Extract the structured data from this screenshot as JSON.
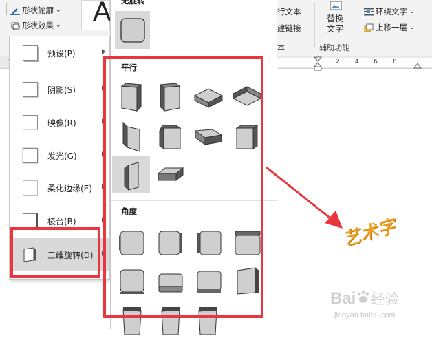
{
  "ribbon": {
    "shape_outline": "形状轮廓",
    "shape_effects": "形状效果",
    "big_letter": "A",
    "wrap_text_partial": "行文本",
    "link_partial": "建链接",
    "group_partial": "本",
    "alt_text_line1": "替换",
    "alt_text_line2": "文字",
    "accessibility_group": "辅助功能",
    "wrap_text": "环绕文字",
    "bring_forward": "上移一层"
  },
  "ruler": {
    "numbers": [
      "3",
      "2",
      "4",
      "6",
      "8"
    ]
  },
  "menu": {
    "items": [
      {
        "label": "预设(P)"
      },
      {
        "label": "阴影(S)"
      },
      {
        "label": "映像(R)"
      },
      {
        "label": "发光(G)"
      },
      {
        "label": "柔化边缘(E)"
      },
      {
        "label": "棱台(B)"
      },
      {
        "label": "三维旋转(D)"
      }
    ]
  },
  "submenu": {
    "no_rotation_title": "无旋转",
    "parallel_title": "平行",
    "angle_title": "角度"
  },
  "watermark": {
    "art_text": "艺术字",
    "baidu": "Bai",
    "baidu_jingyan": "经验",
    "url": "jingyan.baidu.com"
  },
  "colors": {
    "highlight_red": "#e8383d",
    "arrow_red": "#e8383d",
    "art_text_orange": "#f0a020"
  }
}
